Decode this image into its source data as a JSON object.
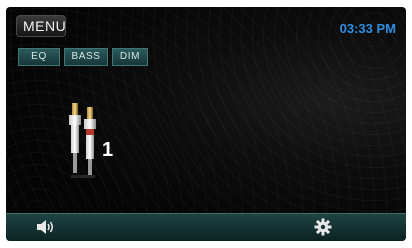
{
  "header": {
    "menu_label": "MENU",
    "time": "03:33 PM"
  },
  "audio_controls": [
    {
      "label": "EQ"
    },
    {
      "label": "BASS"
    },
    {
      "label": "DIM"
    }
  ],
  "source": {
    "icon": "rca-plugs-icon",
    "number": "1"
  },
  "bottom_bar": {
    "volume_icon": "speaker-icon",
    "settings_icon": "gear-icon"
  },
  "colors": {
    "clock": "#2e8fe0",
    "bar": "#1e4443",
    "pill": "#2c5b5c"
  }
}
